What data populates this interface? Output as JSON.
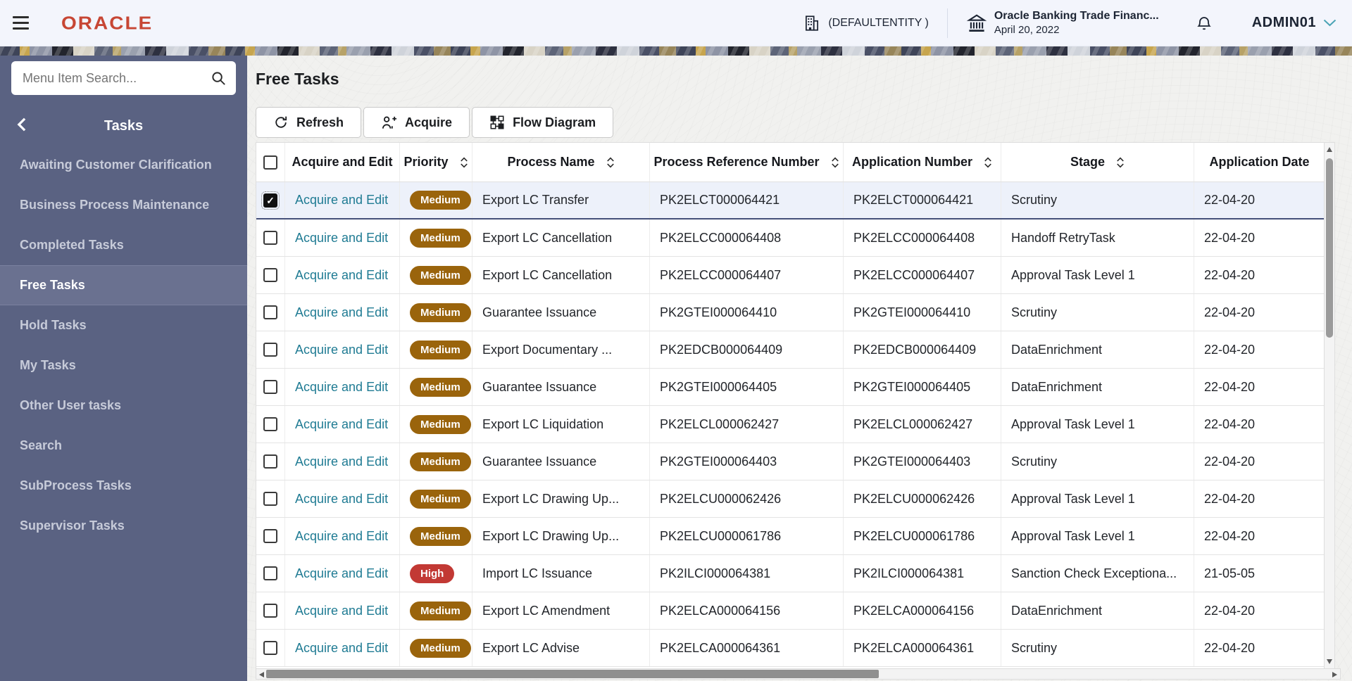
{
  "header": {
    "logo": "ORACLE",
    "entity_label": "(DEFAULTENTITY )",
    "app_name": "Oracle Banking Trade Financ...",
    "app_date": "April 20, 2022",
    "user": "ADMIN01"
  },
  "sidebar": {
    "search_placeholder": "Menu Item Search...",
    "panel_title": "Tasks",
    "items": [
      {
        "label": "Awaiting Customer Clarification",
        "selected": false
      },
      {
        "label": "Business Process Maintenance",
        "selected": false
      },
      {
        "label": "Completed Tasks",
        "selected": false
      },
      {
        "label": "Free Tasks",
        "selected": true
      },
      {
        "label": "Hold Tasks",
        "selected": false
      },
      {
        "label": "My Tasks",
        "selected": false
      },
      {
        "label": "Other User tasks",
        "selected": false
      },
      {
        "label": "Search",
        "selected": false
      },
      {
        "label": "SubProcess Tasks",
        "selected": false
      },
      {
        "label": "Supervisor Tasks",
        "selected": false
      }
    ]
  },
  "main": {
    "title": "Free Tasks",
    "toolbar": {
      "refresh": "Refresh",
      "acquire": "Acquire",
      "flow_diagram": "Flow Diagram"
    },
    "table": {
      "columns": [
        {
          "id": "select",
          "label": "",
          "sortable": false
        },
        {
          "id": "action",
          "label": "Acquire and Edit",
          "sortable": false
        },
        {
          "id": "priority",
          "label": "Priority",
          "sortable": true
        },
        {
          "id": "process_name",
          "label": "Process Name",
          "sortable": true
        },
        {
          "id": "process_ref",
          "label": "Process Reference Number",
          "sortable": true
        },
        {
          "id": "app_number",
          "label": "Application Number",
          "sortable": true
        },
        {
          "id": "stage",
          "label": "Stage",
          "sortable": true
        },
        {
          "id": "app_date",
          "label": "Application Date",
          "sortable": false
        }
      ],
      "rows": [
        {
          "checked": true,
          "selected": true,
          "action": "Acquire and Edit",
          "priority": "Medium",
          "process_name": "Export LC Transfer",
          "process_ref": "PK2ELCT000064421",
          "app_number": "PK2ELCT000064421",
          "stage": "Scrutiny",
          "app_date": "22-04-20"
        },
        {
          "checked": false,
          "selected": false,
          "action": "Acquire and Edit",
          "priority": "Medium",
          "process_name": "Export LC Cancellation",
          "process_ref": "PK2ELCC000064408",
          "app_number": "PK2ELCC000064408",
          "stage": "Handoff RetryTask",
          "app_date": "22-04-20"
        },
        {
          "checked": false,
          "selected": false,
          "action": "Acquire and Edit",
          "priority": "Medium",
          "process_name": "Export LC Cancellation",
          "process_ref": "PK2ELCC000064407",
          "app_number": "PK2ELCC000064407",
          "stage": "Approval Task Level 1",
          "app_date": "22-04-20"
        },
        {
          "checked": false,
          "selected": false,
          "action": "Acquire and Edit",
          "priority": "Medium",
          "process_name": "Guarantee Issuance",
          "process_ref": "PK2GTEI000064410",
          "app_number": "PK2GTEI000064410",
          "stage": "Scrutiny",
          "app_date": "22-04-20"
        },
        {
          "checked": false,
          "selected": false,
          "action": "Acquire and Edit",
          "priority": "Medium",
          "process_name": "Export Documentary ...",
          "process_ref": "PK2EDCB000064409",
          "app_number": "PK2EDCB000064409",
          "stage": "DataEnrichment",
          "app_date": "22-04-20"
        },
        {
          "checked": false,
          "selected": false,
          "action": "Acquire and Edit",
          "priority": "Medium",
          "process_name": "Guarantee Issuance",
          "process_ref": "PK2GTEI000064405",
          "app_number": "PK2GTEI000064405",
          "stage": "DataEnrichment",
          "app_date": "22-04-20"
        },
        {
          "checked": false,
          "selected": false,
          "action": "Acquire and Edit",
          "priority": "Medium",
          "process_name": "Export LC Liquidation",
          "process_ref": "PK2ELCL000062427",
          "app_number": "PK2ELCL000062427",
          "stage": "Approval Task Level 1",
          "app_date": "22-04-20"
        },
        {
          "checked": false,
          "selected": false,
          "action": "Acquire and Edit",
          "priority": "Medium",
          "process_name": "Guarantee Issuance",
          "process_ref": "PK2GTEI000064403",
          "app_number": "PK2GTEI000064403",
          "stage": "Scrutiny",
          "app_date": "22-04-20"
        },
        {
          "checked": false,
          "selected": false,
          "action": "Acquire and Edit",
          "priority": "Medium",
          "process_name": "Export LC Drawing Up...",
          "process_ref": "PK2ELCU000062426",
          "app_number": "PK2ELCU000062426",
          "stage": "Approval Task Level 1",
          "app_date": "22-04-20"
        },
        {
          "checked": false,
          "selected": false,
          "action": "Acquire and Edit",
          "priority": "Medium",
          "process_name": "Export LC Drawing Up...",
          "process_ref": "PK2ELCU000061786",
          "app_number": "PK2ELCU000061786",
          "stage": "Approval Task Level 1",
          "app_date": "22-04-20"
        },
        {
          "checked": false,
          "selected": false,
          "action": "Acquire and Edit",
          "priority": "High",
          "process_name": "Import LC Issuance",
          "process_ref": "PK2ILCI000064381",
          "app_number": "PK2ILCI000064381",
          "stage": "Sanction Check Exceptiona...",
          "app_date": "21-05-05"
        },
        {
          "checked": false,
          "selected": false,
          "action": "Acquire and Edit",
          "priority": "Medium",
          "process_name": "Export LC Amendment",
          "process_ref": "PK2ELCA000064156",
          "app_number": "PK2ELCA000064156",
          "stage": "DataEnrichment",
          "app_date": "22-04-20"
        },
        {
          "checked": false,
          "selected": false,
          "action": "Acquire and Edit",
          "priority": "Medium",
          "process_name": "Export LC Advise",
          "process_ref": "PK2ELCA000064361",
          "app_number": "PK2ELCA000064361",
          "stage": "Scrutiny",
          "app_date": "22-04-20"
        }
      ]
    }
  },
  "colors": {
    "oracle_red": "#c74634",
    "sidebar_bg": "#5a6282",
    "sidebar_selected_bg": "#6a7190",
    "link_teal": "#1f7b93",
    "priority_medium": "#9a640c",
    "priority_high": "#c23934",
    "selected_row_bg": "#edf1fa"
  }
}
